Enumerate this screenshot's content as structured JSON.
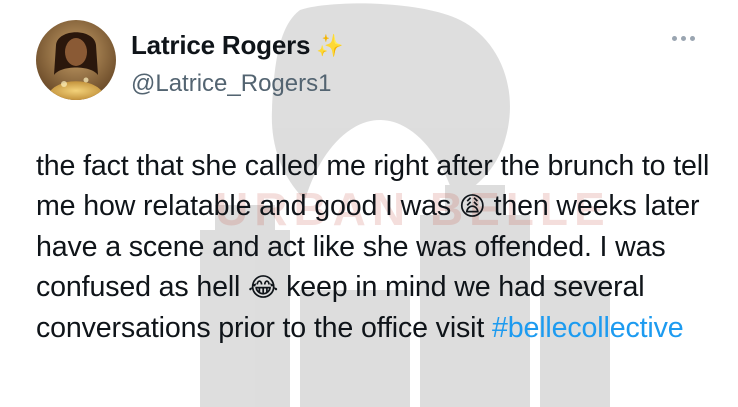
{
  "author": {
    "name": "Latrice Rogers",
    "badge": "✨",
    "handle": "@Latrice_Rogers1"
  },
  "watermark": {
    "text": "URBAN BELLE"
  },
  "tweet": {
    "part1": "the fact that she called me right after the brunch to tell me how relatable and good I was",
    "emoji1": "😩",
    "part2": "then weeks later have a scene and act like she was offended. I was confused as hell",
    "emoji2": "😂",
    "part3": "keep in mind we had several conversations prior to the office visit",
    "hashtag": "#bellecollective"
  },
  "colors": {
    "text": "#0f1419",
    "secondary": "#536471",
    "link": "#1d9bf0",
    "watermark_red": "#c0392b"
  }
}
